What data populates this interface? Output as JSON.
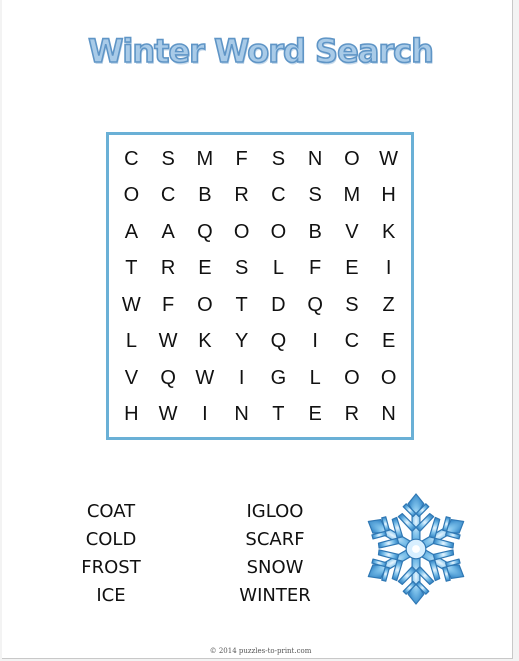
{
  "title": "Winter Word Search",
  "grid": [
    [
      "C",
      "S",
      "M",
      "F",
      "S",
      "N",
      "O",
      "W"
    ],
    [
      "O",
      "C",
      "B",
      "R",
      "C",
      "S",
      "M",
      "H"
    ],
    [
      "A",
      "A",
      "Q",
      "O",
      "O",
      "B",
      "V",
      "K"
    ],
    [
      "T",
      "R",
      "E",
      "S",
      "L",
      "F",
      "E",
      "I"
    ],
    [
      "W",
      "F",
      "O",
      "T",
      "D",
      "Q",
      "S",
      "Z"
    ],
    [
      "L",
      "W",
      "K",
      "Y",
      "Q",
      "I",
      "C",
      "E"
    ],
    [
      "V",
      "Q",
      "W",
      "I",
      "G",
      "L",
      "O",
      "O"
    ],
    [
      "H",
      "W",
      "I",
      "N",
      "T",
      "E",
      "R",
      "N"
    ]
  ],
  "words": {
    "column1": [
      "COAT",
      "COLD",
      "FROST",
      "ICE"
    ],
    "column2": [
      "IGLOO",
      "SCARF",
      "SNOW",
      "WINTER"
    ]
  },
  "footer": "© 2014 puzzles-to-print.com",
  "colors": {
    "title_fill": "#a9cbe8",
    "title_stroke": "#5f95c6",
    "grid_border": "#6ab0d6",
    "snowflake": "#5ea9da"
  },
  "decoration": "snowflake-icon"
}
